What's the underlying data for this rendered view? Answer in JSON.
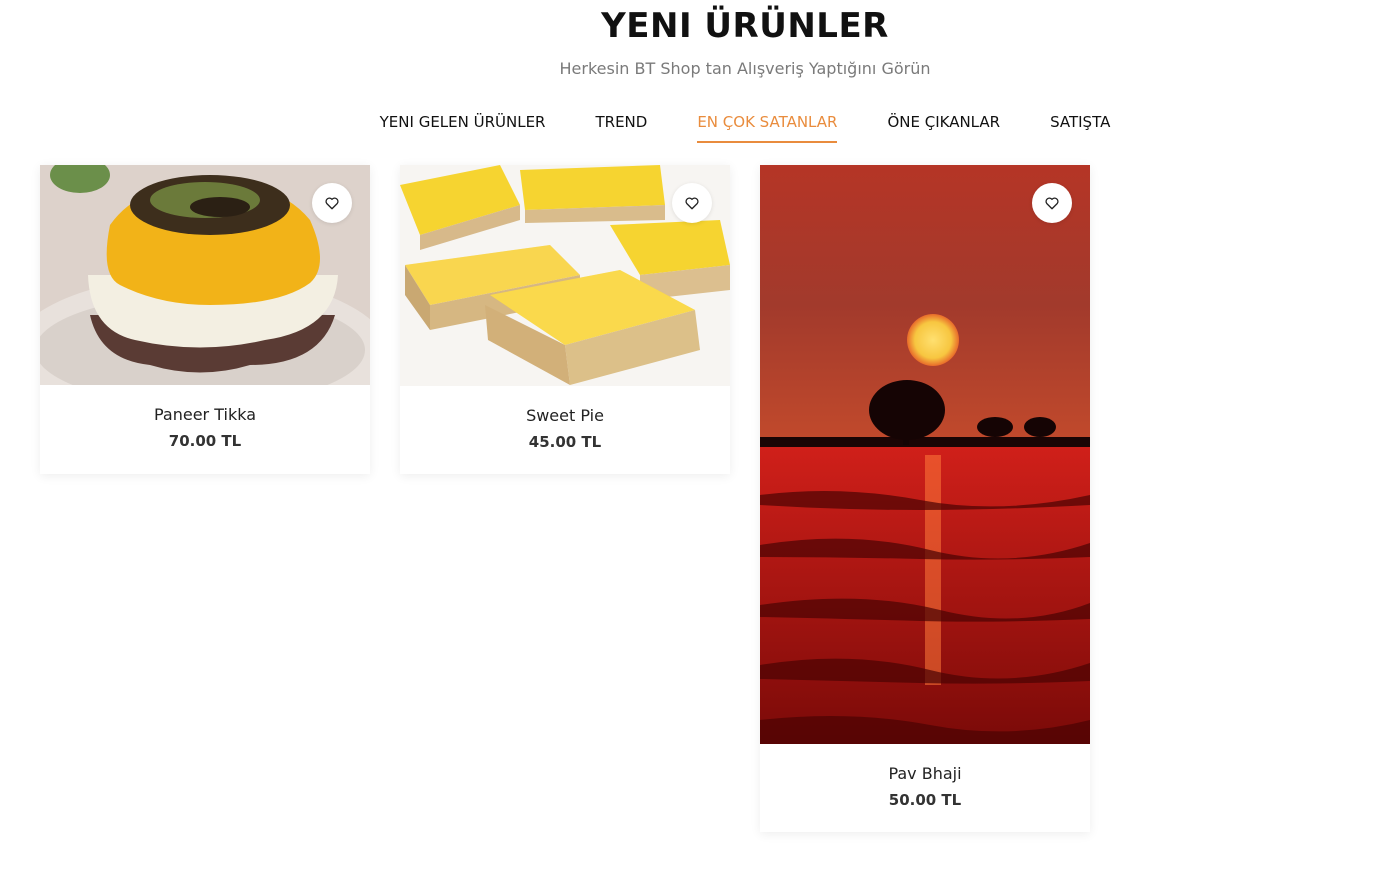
{
  "section": {
    "title": "YENI ÜRÜNLER",
    "subtitle": "Herkesin BT Shop tan Alışveriş Yaptığını Görün"
  },
  "tabs": [
    {
      "label": "YENI GELEN ÜRÜNLER",
      "active": false
    },
    {
      "label": "TREND",
      "active": false
    },
    {
      "label": "EN ÇOK SATANLAR",
      "active": true
    },
    {
      "label": "ÖNE ÇIKANLAR",
      "active": false
    },
    {
      "label": "SATIŞTA",
      "active": false
    }
  ],
  "accent_color": "#e98c3d",
  "products": [
    {
      "name": "Paneer Tikka",
      "price": "70.00 TL",
      "wishlist_icon": "heart-icon"
    },
    {
      "name": "Sweet Pie",
      "price": "45.00 TL",
      "wishlist_icon": "heart-icon"
    },
    {
      "name": "Pav Bhaji",
      "price": "50.00 TL",
      "wishlist_icon": "heart-icon"
    }
  ]
}
